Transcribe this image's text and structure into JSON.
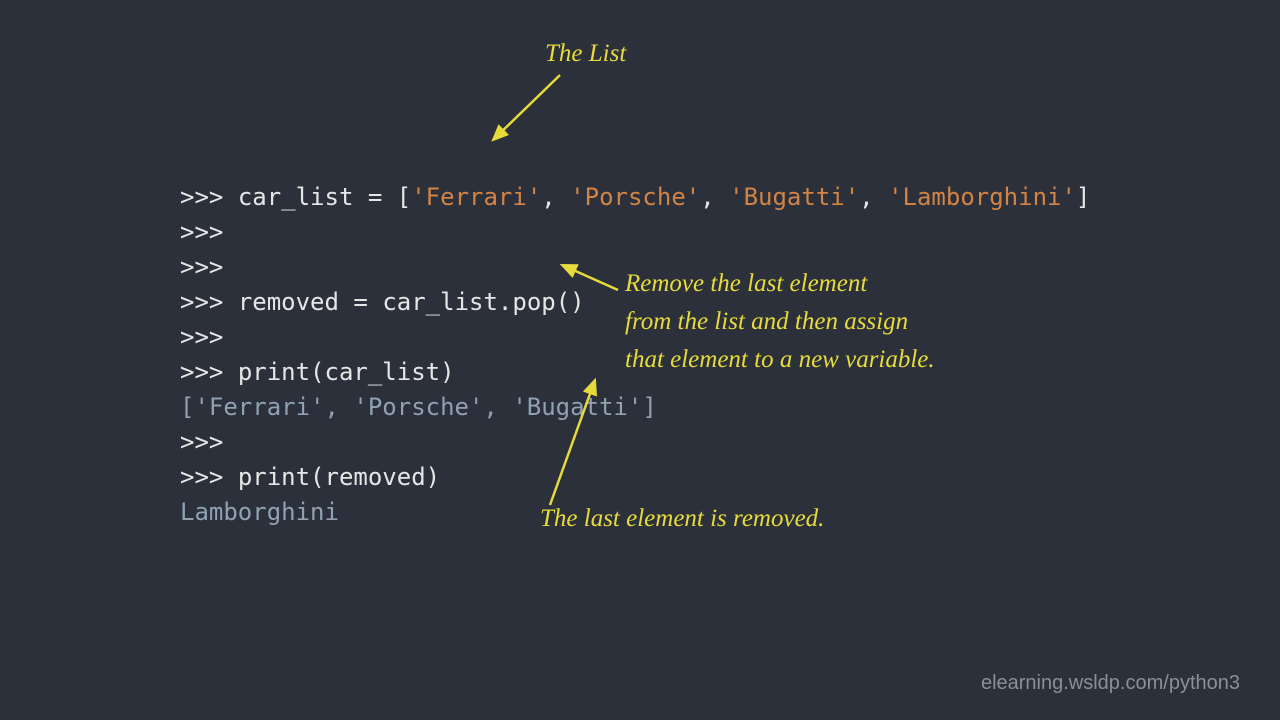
{
  "code": {
    "prompt": ">>>",
    "line1": {
      "var": "car_list",
      "eq": "=",
      "lb": "[",
      "s1": "'Ferrari'",
      "c1": ",",
      "s2": "'Porsche'",
      "c2": ",",
      "s3": "'Bugatti'",
      "c3": ",",
      "s4": "'Lamborghini'",
      "rb": "]"
    },
    "line4": {
      "var": "removed",
      "eq": "=",
      "call": "car_list.pop()"
    },
    "line6": {
      "call": "print(car_list)"
    },
    "line7_output": "['Ferrari', 'Porsche', 'Bugatti']",
    "line9": {
      "call": "print(removed)"
    },
    "line10_output": "Lamborghini"
  },
  "annotations": {
    "top": "The List",
    "right1": "Remove the last element",
    "right2": "from the list and then assign",
    "right3": "that element to a new variable.",
    "bottom": "The last element is removed."
  },
  "watermark": "elearning.wsldp.com/python3",
  "colors": {
    "bg": "#2b303b",
    "text": "#e6e6e6",
    "string": "#d28445",
    "output": "#8fa1b3",
    "annot": "#e6db3b"
  }
}
